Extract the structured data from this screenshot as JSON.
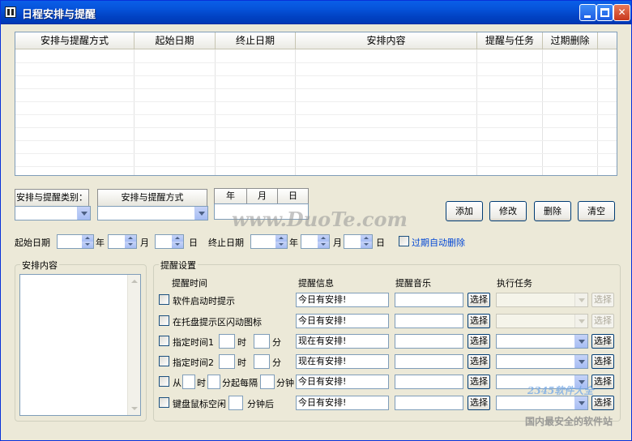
{
  "window": {
    "title": "日程安排与提醒"
  },
  "list": {
    "columns": [
      "安排与提醒方式",
      "起始日期",
      "终止日期",
      "安排内容",
      "提醒与任务",
      "过期删除"
    ]
  },
  "filters": {
    "category_label": "安排与提醒类别：",
    "mode_label": "安排与提醒方式",
    "year_header": "年",
    "month_header": "月",
    "day_header": "日"
  },
  "actions": {
    "add": "添加",
    "modify": "修改",
    "delete": "删除",
    "clear": "清空"
  },
  "dates": {
    "start_label": "起始日期",
    "end_label": "终止日期",
    "year_unit": "年",
    "month_unit": "月",
    "day_unit": "日",
    "auto_delete": "过期自动删除"
  },
  "content_group": {
    "label": "安排内容"
  },
  "reminder": {
    "group_label": "提醒设置",
    "col_time": "提醒时间",
    "col_info": "提醒信息",
    "col_music": "提醒音乐",
    "col_task": "执行任务",
    "select_label": "选择",
    "rows": [
      {
        "label": "软件启动时提示",
        "info": "今日有安排!"
      },
      {
        "label": "在托盘提示区闪动图标",
        "info": "今日有安排!"
      },
      {
        "label": "指定时间1",
        "hour_unit": "时",
        "minute_unit": "分",
        "info": "现在有安排!"
      },
      {
        "label": "指定时间2",
        "hour_unit": "时",
        "minute_unit": "分",
        "info": "现在有安排!"
      },
      {
        "label": "从",
        "hour_unit": "时",
        "minute_unit": "分起每隔",
        "interval_unit": "分钟",
        "info": "今日有安排!"
      },
      {
        "label": "键盘鼠标空闲",
        "idle_unit": "分钟后",
        "info": "今日有安排!"
      }
    ]
  },
  "watermark": {
    "main": "www.DuoTe.com",
    "corner_brand": "2345软件大全",
    "corner_slogan": "国内最安全的软件站"
  }
}
